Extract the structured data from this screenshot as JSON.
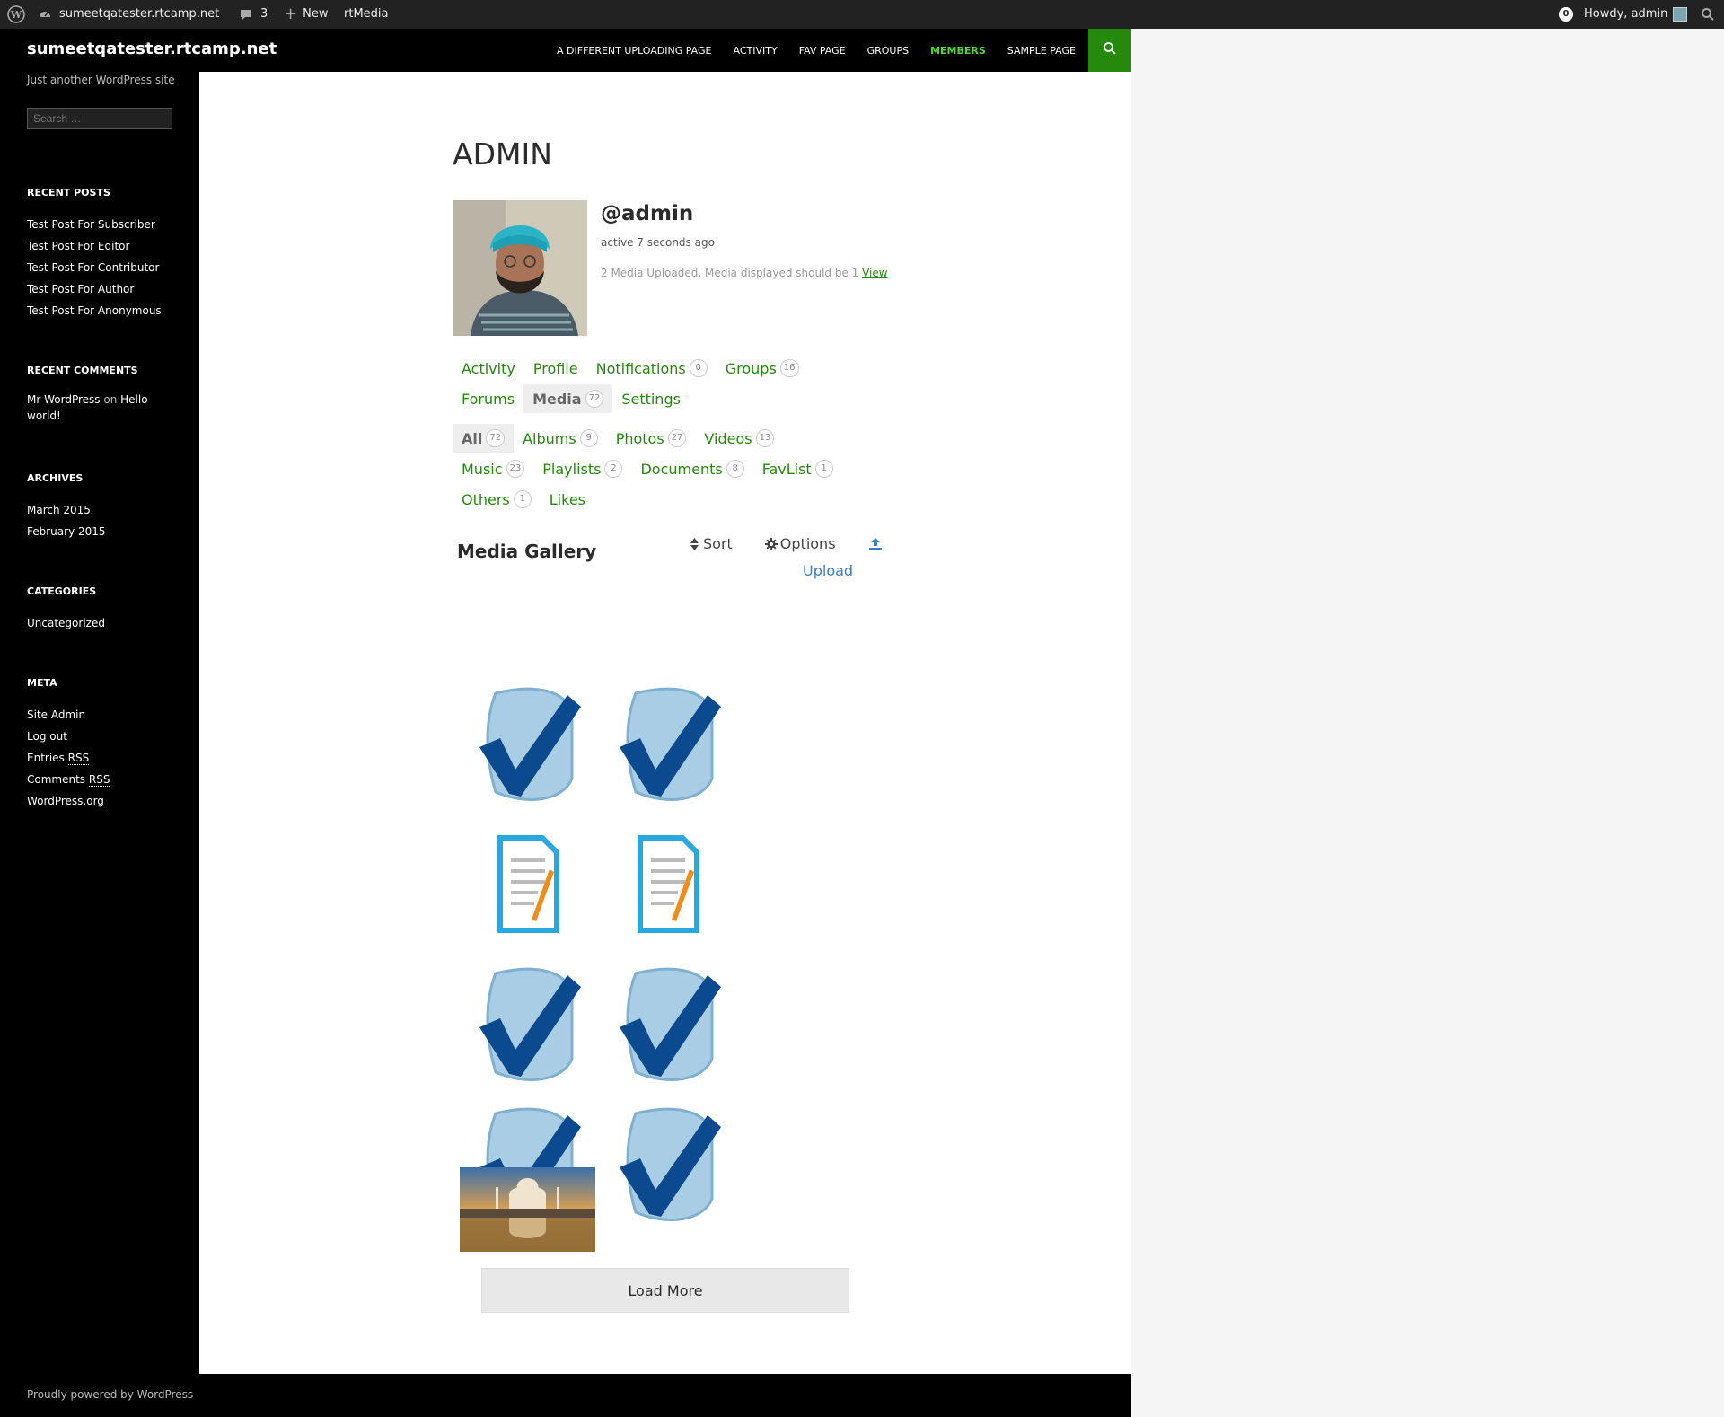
{
  "adminbar": {
    "site_name": "sumeetqatester.rtcamp.net",
    "comments_count": "3",
    "new_label": "New",
    "rtmedia_label": "rtMedia",
    "notif_count": "0",
    "howdy": "Howdy, admin"
  },
  "header": {
    "site_title": "sumeetqatester.rtcamp.net",
    "nav": [
      "A DIFFERENT UPLOADING PAGE",
      "ACTIVITY",
      "FAV PAGE",
      "GROUPS",
      "MEMBERS",
      "SAMPLE PAGE"
    ],
    "current_nav": "MEMBERS"
  },
  "sidebar": {
    "tagline": "Just another WordPress site",
    "search_placeholder": "Search …",
    "recent_posts_title": "RECENT POSTS",
    "recent_posts": [
      "Test Post For Subscriber",
      "Test Post For Editor",
      "Test Post For Contributor",
      "Test Post For Author",
      "Test Post For Anonymous"
    ],
    "recent_comments_title": "RECENT COMMENTS",
    "comment_author": "Mr WordPress",
    "comment_on": "on",
    "comment_post": "Hello world!",
    "archives_title": "ARCHIVES",
    "archives": [
      "March 2015",
      "February 2015"
    ],
    "categories_title": "CATEGORIES",
    "categories": [
      "Uncategorized"
    ],
    "meta_title": "META",
    "meta": {
      "site_admin": "Site Admin",
      "log_out": "Log out",
      "entries": "Entries",
      "comments": "Comments",
      "rss": "RSS",
      "wordpress_org": "WordPress.org"
    }
  },
  "profile": {
    "page_title": "ADMIN",
    "username": "@admin",
    "activity": "active 7 seconds ago",
    "media_note": "2 Media Uploaded. Media displayed should be 1",
    "view_link": "View"
  },
  "main_tabs": [
    {
      "label": "Activity",
      "count": null
    },
    {
      "label": "Profile",
      "count": null
    },
    {
      "label": "Notifications",
      "count": "0"
    },
    {
      "label": "Groups",
      "count": "16"
    },
    {
      "label": "Forums",
      "count": null
    },
    {
      "label": "Media",
      "count": "72"
    },
    {
      "label": "Settings",
      "count": null
    }
  ],
  "media_tabs": [
    {
      "label": "All",
      "count": "72"
    },
    {
      "label": "Albums",
      "count": "9"
    },
    {
      "label": "Photos",
      "count": "27"
    },
    {
      "label": "Videos",
      "count": "13"
    },
    {
      "label": "Music",
      "count": "23"
    },
    {
      "label": "Playlists",
      "count": "2"
    },
    {
      "label": "Documents",
      "count": "8"
    },
    {
      "label": "FavList",
      "count": "1"
    },
    {
      "label": "Others",
      "count": "1"
    },
    {
      "label": "Likes",
      "count": null
    }
  ],
  "gallery": {
    "title": "Media Gallery",
    "sort_label": "Sort",
    "options_label": "Options",
    "upload_label": "Upload",
    "items": [
      "checkmark-icon",
      "checkmark-icon",
      "document-icon",
      "document-icon",
      "checkmark-icon",
      "checkmark-icon",
      "checkmark-icon",
      "checkmark-icon",
      "taj-mahal-photo"
    ],
    "load_more": "Load More"
  },
  "footer": {
    "text": "Proudly powered by WordPress"
  },
  "colors": {
    "accent": "#24890d",
    "nav_current": "#55d737",
    "link_blue": "#3b7cc7"
  }
}
